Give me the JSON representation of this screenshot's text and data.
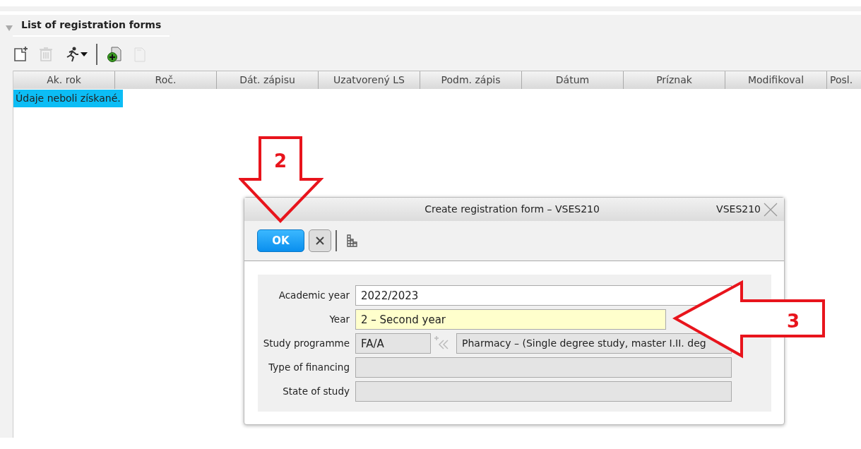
{
  "panel": {
    "title": "List of registration forms",
    "expanded": true
  },
  "toolbar": [
    {
      "kind": "new",
      "disabled": false
    },
    {
      "kind": "delete",
      "disabled": true
    },
    {
      "kind": "run",
      "disabled": false
    },
    {
      "kind": "separator",
      "disabled": false
    },
    {
      "kind": "add-document",
      "disabled": false
    },
    {
      "kind": "copy",
      "disabled": true
    }
  ],
  "table": {
    "columns": [
      "Ak. rok",
      "Roč.",
      "Dát. zápisu",
      "Uzatvorený LS",
      "Podm. zápis",
      "Dátum",
      "Príznak",
      "Modifikoval",
      "Posl."
    ],
    "message": "Údaje neboli získané."
  },
  "dialog": {
    "title": "Create registration form – VSES210",
    "code": "VSES210",
    "ok": "OK",
    "fields": [
      {
        "kind": "combo",
        "label": "Academic year",
        "value": "2022/2023"
      },
      {
        "kind": "highlighted",
        "label": "Year",
        "value": "2 – Second year"
      },
      {
        "kind": "programme",
        "label": "Study programme",
        "code": "FA/A",
        "value": "Pharmacy – (Single degree study, master I.II. deg"
      },
      {
        "kind": "readonly",
        "label": "Type of financing"
      },
      {
        "kind": "readonly",
        "label": "State of study"
      }
    ]
  },
  "callouts": [
    {
      "kind": "down",
      "number": "2"
    },
    {
      "kind": "left",
      "number": "3"
    }
  ]
}
